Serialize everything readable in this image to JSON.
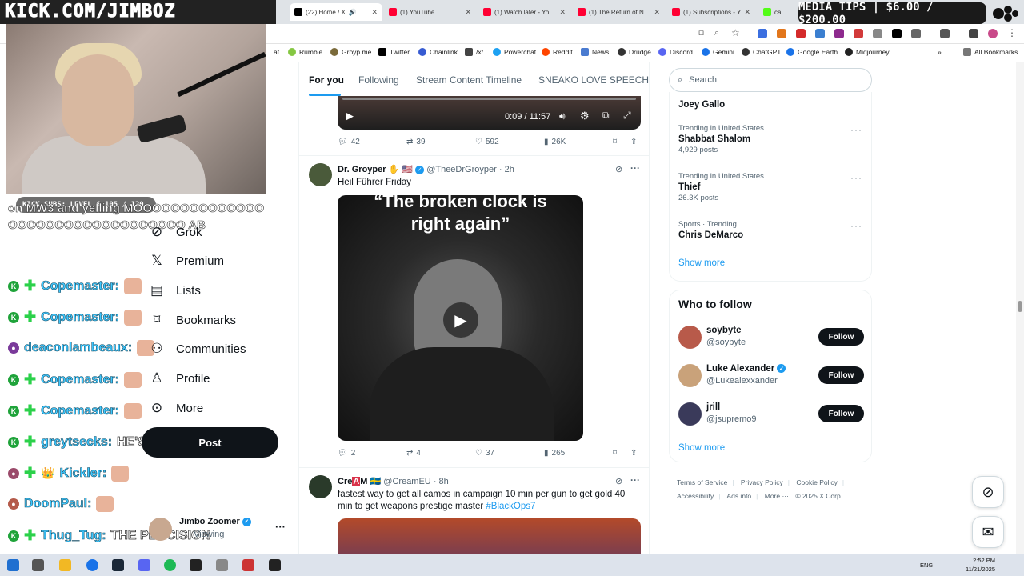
{
  "overlay": {
    "kick_url": "KICK.COM/JIMBOZ",
    "kick_subs": "KICK SUBS: LEVEL 6 105 / 120",
    "media_tips": "MEDIA TIPS | $6.00 / $200.00"
  },
  "browser": {
    "tabs": [
      {
        "label": "(22) Home / X",
        "color": "#000000"
      },
      {
        "label": "(1) YouTube",
        "color": "#ff0033"
      },
      {
        "label": "(1) Watch later - Yo",
        "color": "#ff0033"
      },
      {
        "label": "(1) The Return of N",
        "color": "#ff0033"
      },
      {
        "label": "(1) Subscriptions - Y",
        "color": "#ff0033"
      },
      {
        "label": "ca",
        "color": "#53fc18"
      }
    ],
    "bookmarks": [
      {
        "label": "at",
        "color": "#888888"
      },
      {
        "label": "Rumble",
        "color": "#85c742"
      },
      {
        "label": "Groyp.me",
        "color": "#7a6a3a"
      },
      {
        "label": "Twitter",
        "color": "#000000"
      },
      {
        "label": "Chainlink",
        "color": "#375bd2"
      },
      {
        "label": "/x/",
        "color": "#444444"
      },
      {
        "label": "Powerchat",
        "color": "#1da1f2"
      },
      {
        "label": "Reddit",
        "color": "#ff4500"
      },
      {
        "label": "News",
        "color": "#4a7bd0"
      },
      {
        "label": "Drudge",
        "color": "#333333"
      },
      {
        "label": "Discord",
        "color": "#5865f2"
      },
      {
        "label": "Gemini",
        "color": "#1a73e8"
      },
      {
        "label": "ChatGPT",
        "color": "#333333"
      },
      {
        "label": "Google Earth",
        "color": "#1a73e8"
      },
      {
        "label": "Midjourney",
        "color": "#222222"
      }
    ],
    "all_bookmarks": "All Bookmarks"
  },
  "chat": {
    "partial": "on MW3 and yelling MOOOOOOOOOOOOOOOOOOOOOOOOOOOOOOOOO AB",
    "lines": [
      {
        "user": "Copemaster:",
        "msg": ""
      },
      {
        "user": "Copemaster:",
        "msg": ""
      },
      {
        "user": "deaconlambeaux:",
        "msg": ""
      },
      {
        "user": "Copemaster:",
        "msg": ""
      },
      {
        "user": "Copemaster:",
        "msg": ""
      },
      {
        "user": "greytsecks:",
        "msg": "HE'S ALIVE"
      },
      {
        "user": "Kickler:",
        "msg": ""
      },
      {
        "user": "DoomPaul:",
        "msg": ""
      },
      {
        "user": "Thug_Tug:",
        "msg": "THE PERCISION"
      }
    ]
  },
  "nav": {
    "items": [
      {
        "label": "Grok",
        "icon": "grok-icon"
      },
      {
        "label": "Premium",
        "icon": "x-logo-icon"
      },
      {
        "label": "Lists",
        "icon": "list-icon"
      },
      {
        "label": "Bookmarks",
        "icon": "bookmark-icon"
      },
      {
        "label": "Communities",
        "icon": "communities-icon"
      },
      {
        "label": "Profile",
        "icon": "profile-icon"
      },
      {
        "label": "More",
        "icon": "more-circle-icon"
      }
    ],
    "post_label": "Post",
    "account_name": "Jimbo Zoomer",
    "account_status": "Viewing"
  },
  "timeline": {
    "tabs": [
      "For you",
      "Following",
      "Stream Content Timeline",
      "SNEAKO LOVE SPEECH"
    ],
    "video_time": "0:09 / 11:57",
    "tweet1_stats": {
      "replies": "42",
      "retweets": "39",
      "likes": "592",
      "views": "26K"
    },
    "tweet2": {
      "name": "Dr. Groyper",
      "handle": "@TheeDrGroyper",
      "time": "2h",
      "text": "Heil Führer Friday",
      "media_caption": "“The broken clock is right again”",
      "stats": {
        "replies": "2",
        "retweets": "4",
        "likes": "37",
        "views": "265"
      }
    },
    "tweet3": {
      "name": "Cre",
      "name_suffix": "M",
      "handle": "@CreamEU",
      "time": "8h",
      "text": "fastest way to get all camos in campaign 10 min per gun to get gold 40 min to get weapons prestige master",
      "hashtag": "#BlackOps7"
    }
  },
  "right": {
    "search_placeholder": "Search",
    "top_trend": "Joey Gallo",
    "trends": [
      {
        "context": "Trending in United States",
        "name": "Shabbat Shalom",
        "count": "4,929 posts"
      },
      {
        "context": "Trending in United States",
        "name": "Thief",
        "count": "26.3K posts"
      },
      {
        "context": "Sports · Trending",
        "name": "Chris DeMarco",
        "count": ""
      }
    ],
    "show_more": "Show more",
    "who_to_follow": "Who to follow",
    "follow": [
      {
        "name": "soybyte",
        "handle": "@soybyte",
        "verified": false,
        "color": "#b85a4a"
      },
      {
        "name": "Luke Alexander",
        "handle": "@Lukealexxander",
        "verified": true,
        "color": "#c9a27a"
      },
      {
        "name": "jrill",
        "handle": "@jsupremo9",
        "verified": false,
        "color": "#3a3a5a"
      }
    ],
    "follow_label": "Follow",
    "footer": [
      "Terms of Service",
      "Privacy Policy",
      "Cookie Policy",
      "Accessibility",
      "Ads info",
      "More ···",
      "© 2025 X Corp."
    ]
  },
  "taskbar": {
    "lang": "ENG",
    "time": "2:52 PM",
    "date": "11/21/2025"
  }
}
